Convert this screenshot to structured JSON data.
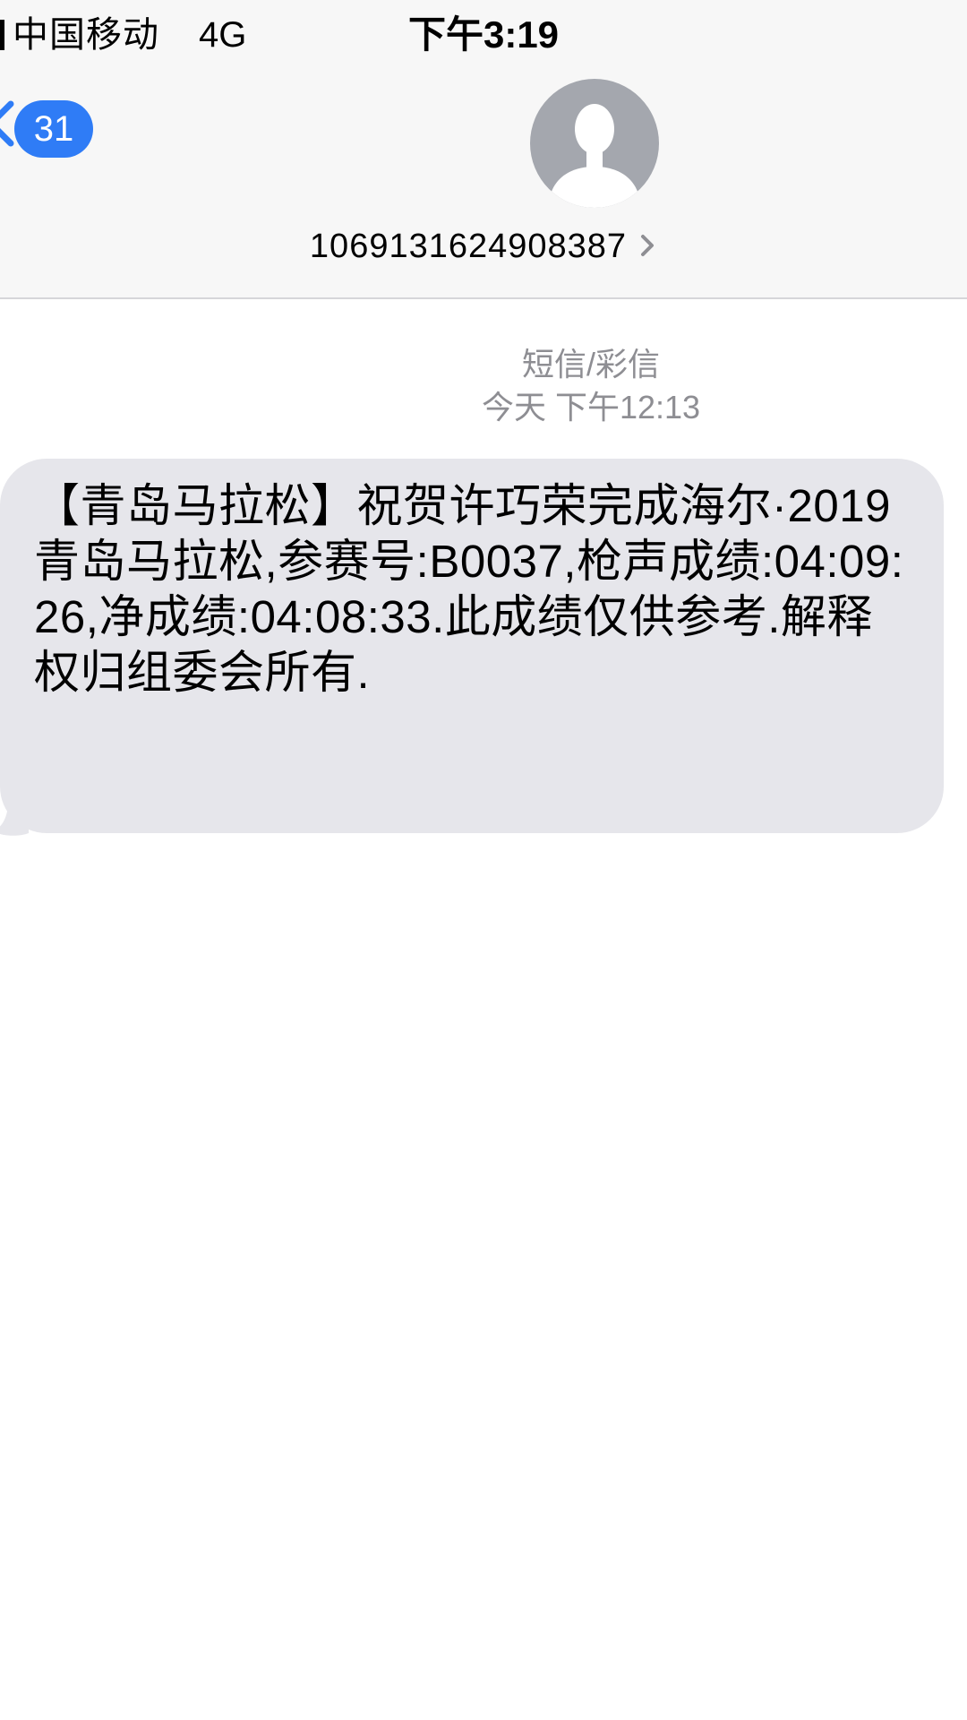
{
  "status_bar": {
    "carrier": "中国移动",
    "network": "4G",
    "time": "下午3:19"
  },
  "nav": {
    "back_badge_count": "31",
    "contact_number": "1069131624908387"
  },
  "thread": {
    "message_type": "短信/彩信",
    "timestamp": "今天 下午12:13"
  },
  "messages": [
    {
      "text": "【青岛马拉松】祝贺许巧荣完成海尔·2019青岛马拉松,参赛号:B0037,枪声成绩:04:09:26,净成绩:04:08:33.此成绩仅供参考.解释权归组委会所有."
    }
  ],
  "colors": {
    "accent": "#2f7cf6",
    "bubble_received": "#e6e6eb",
    "header_bg": "#f7f7f7",
    "meta_text": "#8e8e93",
    "avatar_bg": "#a4a7ae"
  },
  "icons": {
    "back": "chevron-left-icon",
    "avatar": "person-silhouette-icon",
    "contact_detail": "chevron-right-icon"
  }
}
